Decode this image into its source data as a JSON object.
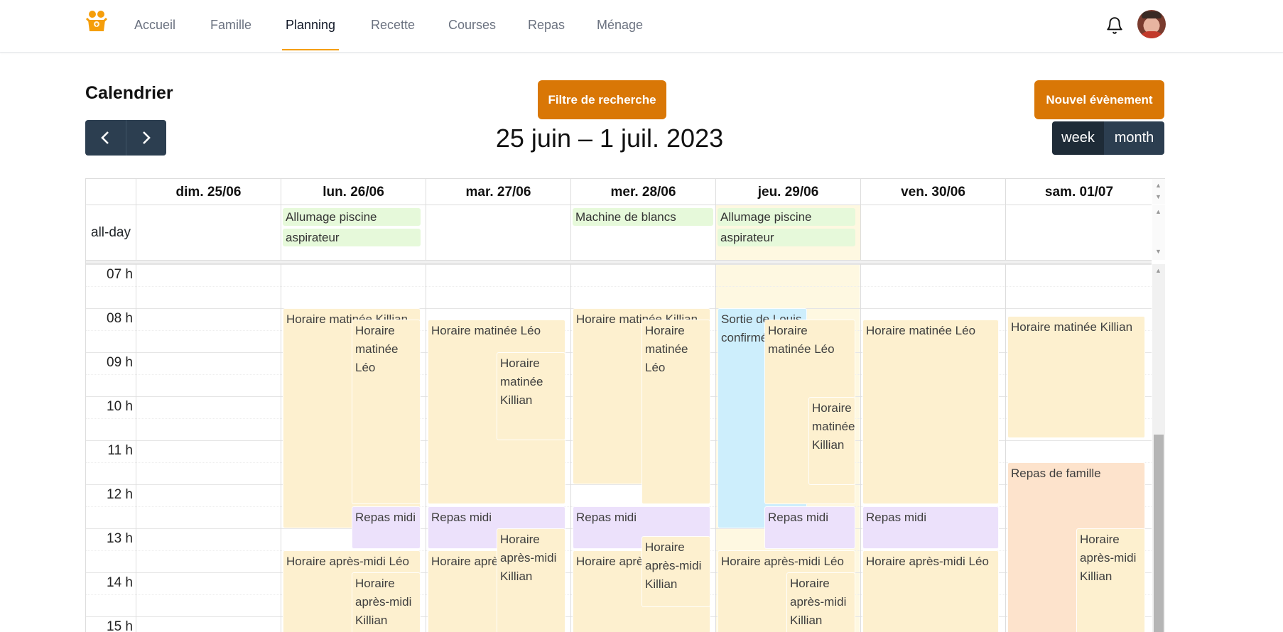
{
  "nav": {
    "items": [
      "Accueil",
      "Famille",
      "Planning",
      "Recette",
      "Courses",
      "Repas",
      "Ménage"
    ],
    "active": "Planning"
  },
  "header": {
    "title": "Calendrier",
    "filter_label": "Filtre de recherche",
    "new_event_label": "Nouvel évènement",
    "range": "25 juin – 1 juil. 2023",
    "prev_icon": "chevron-left-icon",
    "next_icon": "chevron-right-icon",
    "views": [
      "week",
      "month"
    ],
    "active_view": "week"
  },
  "calendar": {
    "days": [
      "dim. 25/06",
      "lun. 26/06",
      "mar. 27/06",
      "mer. 28/06",
      "jeu. 29/06",
      "ven. 30/06",
      "sam. 01/07"
    ],
    "today": "jeu. 29/06",
    "allday_label": "all-day",
    "allday_events": [
      {
        "day": 1,
        "title": "Allumage piscine"
      },
      {
        "day": 1,
        "title": "aspirateur"
      },
      {
        "day": 3,
        "title": "Machine de blancs"
      },
      {
        "day": 4,
        "title": "Allumage piscine"
      },
      {
        "day": 4,
        "title": "aspirateur"
      }
    ],
    "hours": [
      "07 h",
      "08 h",
      "09 h",
      "10 h",
      "11 h",
      "12 h",
      "13 h",
      "14 h",
      "15 h"
    ],
    "events": [
      {
        "day": 1,
        "title": "Horaire matinée Killian",
        "type": "work"
      },
      {
        "day": 1,
        "title": "Horaire matinée Léo",
        "type": "work"
      },
      {
        "day": 1,
        "title": "Repas midi",
        "type": "meal"
      },
      {
        "day": 1,
        "title": "Horaire après-midi Léo",
        "type": "work"
      },
      {
        "day": 1,
        "title": "Horaire après-midi Killian",
        "type": "work"
      },
      {
        "day": 2,
        "title": "Horaire matinée Léo",
        "type": "work"
      },
      {
        "day": 2,
        "title": "Horaire matinée Killian",
        "type": "work"
      },
      {
        "day": 2,
        "title": "Repas midi",
        "type": "meal"
      },
      {
        "day": 2,
        "title": "Horaire après-midi Léo",
        "type": "work"
      },
      {
        "day": 2,
        "title": "Horaire après-midi Killian",
        "type": "work"
      },
      {
        "day": 3,
        "title": "Horaire matinée Killian",
        "type": "work"
      },
      {
        "day": 3,
        "title": "Horaire matinée Léo",
        "type": "work"
      },
      {
        "day": 3,
        "title": "Repas midi",
        "type": "meal"
      },
      {
        "day": 3,
        "title": "Horaire après-midi Léo",
        "type": "work"
      },
      {
        "day": 3,
        "title": "Horaire après-midi Killian",
        "type": "work"
      },
      {
        "day": 4,
        "title": "Sortie de Louis confirmé Killian",
        "type": "outing"
      },
      {
        "day": 4,
        "title": "Horaire matinée Léo",
        "type": "work"
      },
      {
        "day": 4,
        "title": "Horaire matinée Killian",
        "type": "work"
      },
      {
        "day": 4,
        "title": "Repas midi",
        "type": "meal"
      },
      {
        "day": 4,
        "title": "Horaire après-midi Léo",
        "type": "work"
      },
      {
        "day": 4,
        "title": "Horaire après-midi Killian",
        "type": "work"
      },
      {
        "day": 5,
        "title": "Horaire matinée Léo",
        "type": "work"
      },
      {
        "day": 5,
        "title": "Repas midi",
        "type": "meal"
      },
      {
        "day": 5,
        "title": "Horaire après-midi Léo",
        "type": "work"
      },
      {
        "day": 6,
        "title": "Horaire matinée Killian",
        "type": "work"
      },
      {
        "day": 6,
        "title": "Repas de famille",
        "type": "family"
      },
      {
        "day": 6,
        "title": "Horaire après-midi Killian",
        "type": "work"
      }
    ]
  }
}
